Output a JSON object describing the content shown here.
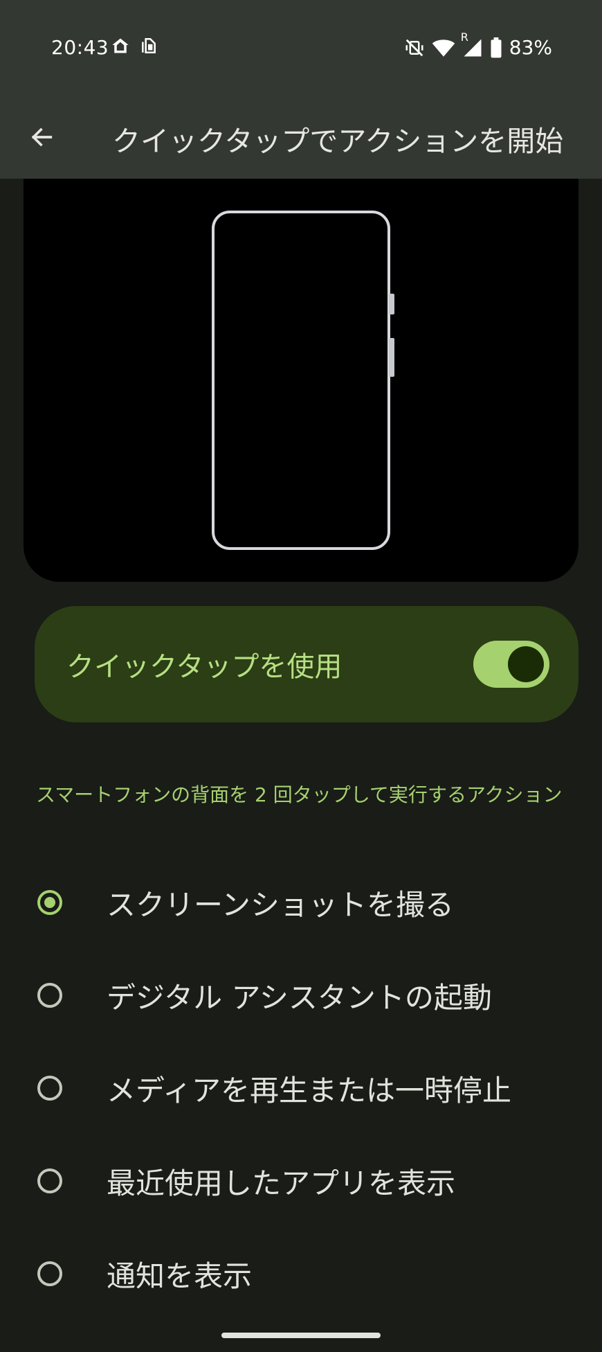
{
  "status_bar": {
    "time": "20:43",
    "battery_percent": "83%",
    "left_icons": [
      "home-icon",
      "app-notification-icon"
    ],
    "right_icons": [
      "vibrate-off-icon",
      "wifi-icon",
      "signal-roaming-icon",
      "battery-icon"
    ],
    "signal_roaming_label": "R"
  },
  "header": {
    "title": "クイックタップでアクションを開始",
    "back_icon": "arrow-back-icon"
  },
  "toggle": {
    "label": "クイックタップを使用",
    "enabled": true
  },
  "section": {
    "header": "スマートフォンの背面を 2 回タップして実行するアクション"
  },
  "options": [
    {
      "label": "スクリーンショットを撮る",
      "selected": true
    },
    {
      "label": "デジタル アシスタントの起動",
      "selected": false
    },
    {
      "label": "メディアを再生または一時停止",
      "selected": false
    },
    {
      "label": "最近使用したアプリを表示",
      "selected": false
    },
    {
      "label": "通知を表示",
      "selected": false
    }
  ],
  "colors": {
    "background": "#191c17",
    "topbar": "#343832",
    "accent": "#a6d16f",
    "toggle_card": "#2c3e15",
    "toggle_label": "#b6e083"
  }
}
